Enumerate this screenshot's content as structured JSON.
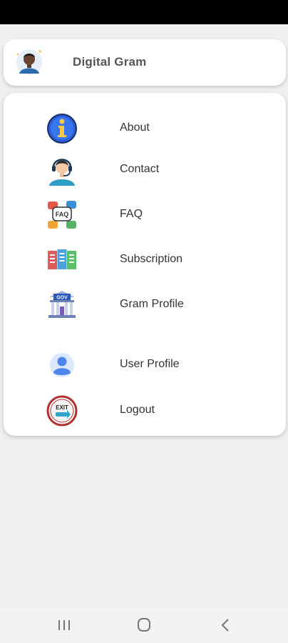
{
  "header": {
    "title": "Digital Gram",
    "avatar_icon": "user-avatar-icon"
  },
  "menu": {
    "items": [
      {
        "label": "About",
        "icon": "info-icon"
      },
      {
        "label": "Contact",
        "icon": "support-agent-icon"
      },
      {
        "label": "FAQ",
        "icon": "faq-icon"
      },
      {
        "label": "Subscription",
        "icon": "folders-icon"
      },
      {
        "label": "Gram Profile",
        "icon": "gov-building-icon"
      },
      {
        "label": "User Profile",
        "icon": "person-icon"
      },
      {
        "label": "Logout",
        "icon": "exit-icon"
      }
    ],
    "exit_sign_text": "EXIT",
    "gov_sign_text": "GOV",
    "faq_bubble_text": "FAQ"
  },
  "colors": {
    "background": "#efefef",
    "card": "#ffffff",
    "status_bar": "#000000",
    "nav_bar": "#f2f2f2"
  },
  "navbar": {
    "icons": [
      "recents-icon",
      "home-icon",
      "back-icon"
    ]
  }
}
